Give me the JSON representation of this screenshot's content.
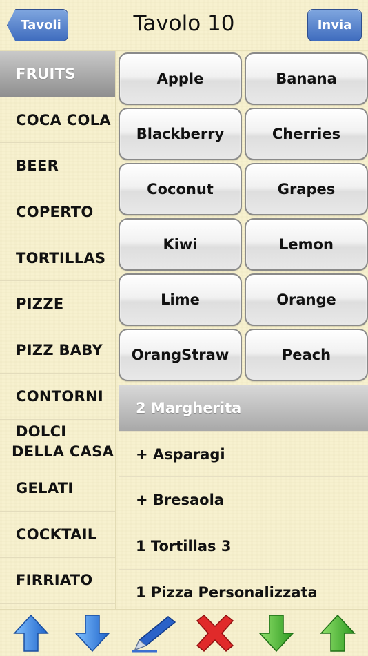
{
  "header": {
    "back_label": "Tavoli",
    "title": "Tavolo 10",
    "send_label": "Invia"
  },
  "sidebar": {
    "items": [
      {
        "label": "FRUITS",
        "selected": true
      },
      {
        "label": "COCA COLA"
      },
      {
        "label": "BEER"
      },
      {
        "label": "COPERTO"
      },
      {
        "label": "TORTILLAS"
      },
      {
        "label": "PIZZE"
      },
      {
        "label": "PIZZ BABY"
      },
      {
        "label": "CONTORNI"
      },
      {
        "label_line1": "DOLCI",
        "label_line2": "DELLA CASA"
      },
      {
        "label": "GELATI"
      },
      {
        "label": "COCKTAIL"
      },
      {
        "label": "FIRRIATO"
      }
    ]
  },
  "products": {
    "buttons": [
      "Apple",
      "Banana",
      "Blackberry",
      "Cherries",
      "Coconut",
      "Grapes",
      "Kiwi",
      "Lemon",
      "Lime",
      "Orange",
      "OrangStraw",
      "Peach"
    ]
  },
  "order": {
    "items": [
      {
        "label": "2 Margherita",
        "selected": true
      },
      {
        "label": "+ Asparagi"
      },
      {
        "label": "+ Bresaola"
      },
      {
        "label": "1 Tortillas 3"
      },
      {
        "label": "1 Pizza Personalizzata"
      }
    ]
  },
  "toolbar": {
    "icons": [
      "arrow-up-blue-icon",
      "arrow-down-blue-icon",
      "pen-icon",
      "delete-x-icon",
      "arrow-down-green-icon",
      "arrow-up-green-icon"
    ]
  },
  "colors": {
    "background": "#f7f1cf",
    "nav_button": "#3f6cbe",
    "selected_row": "#9a9a9a"
  }
}
